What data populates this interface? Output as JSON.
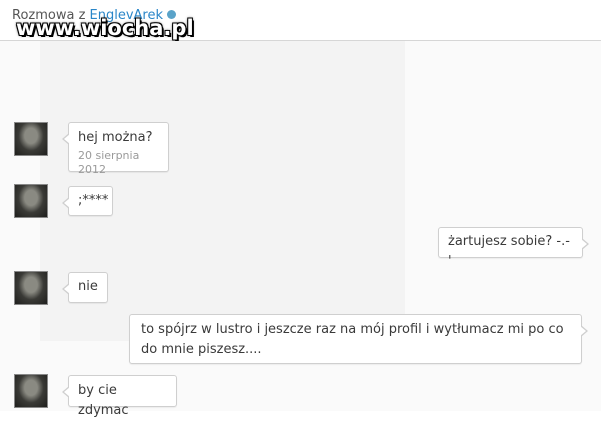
{
  "header": {
    "title_prefix": "Rozmowa z ",
    "user_name": "EnglevArek",
    "status_icon": "online-status-icon"
  },
  "watermark": {
    "text": "www.wiocha.pl"
  },
  "colors": {
    "link": "#2a86c8",
    "status": "#5aa3c9",
    "bubble_border": "#cfcfcf"
  },
  "messages": [
    {
      "side": "left",
      "text": "hej można?",
      "time": "20 sierpnia 2012",
      "has_avatar": true
    },
    {
      "side": "left",
      "text": ";****",
      "has_avatar": true
    },
    {
      "side": "right",
      "text": "żartujesz sobie? -.-'"
    },
    {
      "side": "left",
      "text": "nie",
      "has_avatar": true
    },
    {
      "side": "right",
      "text": "to spójrz w lustro i jeszcze raz na mój profil i wytłumacz mi po co do mnie piszesz...."
    },
    {
      "side": "left",
      "text": "by cie zdymac",
      "has_avatar": true
    }
  ]
}
